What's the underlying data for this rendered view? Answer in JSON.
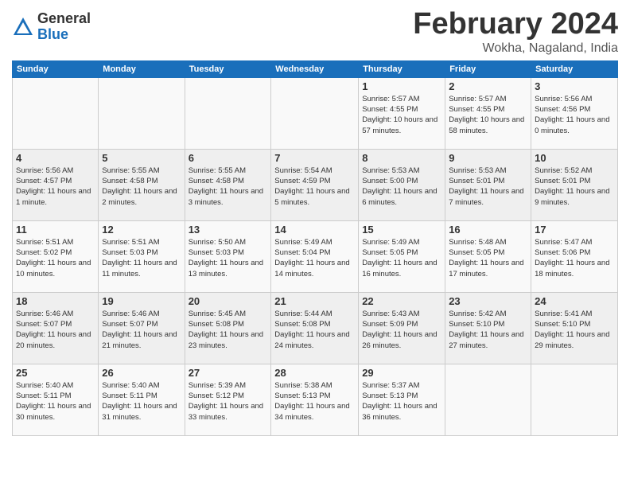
{
  "logo": {
    "general": "General",
    "blue": "Blue"
  },
  "header": {
    "month": "February 2024",
    "location": "Wokha, Nagaland, India"
  },
  "weekdays": [
    "Sunday",
    "Monday",
    "Tuesday",
    "Wednesday",
    "Thursday",
    "Friday",
    "Saturday"
  ],
  "weeks": [
    [
      {
        "day": "",
        "sunrise": "",
        "sunset": "",
        "daylight": ""
      },
      {
        "day": "",
        "sunrise": "",
        "sunset": "",
        "daylight": ""
      },
      {
        "day": "",
        "sunrise": "",
        "sunset": "",
        "daylight": ""
      },
      {
        "day": "",
        "sunrise": "",
        "sunset": "",
        "daylight": ""
      },
      {
        "day": "1",
        "sunrise": "Sunrise: 5:57 AM",
        "sunset": "Sunset: 4:55 PM",
        "daylight": "Daylight: 10 hours and 57 minutes."
      },
      {
        "day": "2",
        "sunrise": "Sunrise: 5:57 AM",
        "sunset": "Sunset: 4:55 PM",
        "daylight": "Daylight: 10 hours and 58 minutes."
      },
      {
        "day": "3",
        "sunrise": "Sunrise: 5:56 AM",
        "sunset": "Sunset: 4:56 PM",
        "daylight": "Daylight: 11 hours and 0 minutes."
      }
    ],
    [
      {
        "day": "4",
        "sunrise": "Sunrise: 5:56 AM",
        "sunset": "Sunset: 4:57 PM",
        "daylight": "Daylight: 11 hours and 1 minute."
      },
      {
        "day": "5",
        "sunrise": "Sunrise: 5:55 AM",
        "sunset": "Sunset: 4:58 PM",
        "daylight": "Daylight: 11 hours and 2 minutes."
      },
      {
        "day": "6",
        "sunrise": "Sunrise: 5:55 AM",
        "sunset": "Sunset: 4:58 PM",
        "daylight": "Daylight: 11 hours and 3 minutes."
      },
      {
        "day": "7",
        "sunrise": "Sunrise: 5:54 AM",
        "sunset": "Sunset: 4:59 PM",
        "daylight": "Daylight: 11 hours and 5 minutes."
      },
      {
        "day": "8",
        "sunrise": "Sunrise: 5:53 AM",
        "sunset": "Sunset: 5:00 PM",
        "daylight": "Daylight: 11 hours and 6 minutes."
      },
      {
        "day": "9",
        "sunrise": "Sunrise: 5:53 AM",
        "sunset": "Sunset: 5:01 PM",
        "daylight": "Daylight: 11 hours and 7 minutes."
      },
      {
        "day": "10",
        "sunrise": "Sunrise: 5:52 AM",
        "sunset": "Sunset: 5:01 PM",
        "daylight": "Daylight: 11 hours and 9 minutes."
      }
    ],
    [
      {
        "day": "11",
        "sunrise": "Sunrise: 5:51 AM",
        "sunset": "Sunset: 5:02 PM",
        "daylight": "Daylight: 11 hours and 10 minutes."
      },
      {
        "day": "12",
        "sunrise": "Sunrise: 5:51 AM",
        "sunset": "Sunset: 5:03 PM",
        "daylight": "Daylight: 11 hours and 11 minutes."
      },
      {
        "day": "13",
        "sunrise": "Sunrise: 5:50 AM",
        "sunset": "Sunset: 5:03 PM",
        "daylight": "Daylight: 11 hours and 13 minutes."
      },
      {
        "day": "14",
        "sunrise": "Sunrise: 5:49 AM",
        "sunset": "Sunset: 5:04 PM",
        "daylight": "Daylight: 11 hours and 14 minutes."
      },
      {
        "day": "15",
        "sunrise": "Sunrise: 5:49 AM",
        "sunset": "Sunset: 5:05 PM",
        "daylight": "Daylight: 11 hours and 16 minutes."
      },
      {
        "day": "16",
        "sunrise": "Sunrise: 5:48 AM",
        "sunset": "Sunset: 5:05 PM",
        "daylight": "Daylight: 11 hours and 17 minutes."
      },
      {
        "day": "17",
        "sunrise": "Sunrise: 5:47 AM",
        "sunset": "Sunset: 5:06 PM",
        "daylight": "Daylight: 11 hours and 18 minutes."
      }
    ],
    [
      {
        "day": "18",
        "sunrise": "Sunrise: 5:46 AM",
        "sunset": "Sunset: 5:07 PM",
        "daylight": "Daylight: 11 hours and 20 minutes."
      },
      {
        "day": "19",
        "sunrise": "Sunrise: 5:46 AM",
        "sunset": "Sunset: 5:07 PM",
        "daylight": "Daylight: 11 hours and 21 minutes."
      },
      {
        "day": "20",
        "sunrise": "Sunrise: 5:45 AM",
        "sunset": "Sunset: 5:08 PM",
        "daylight": "Daylight: 11 hours and 23 minutes."
      },
      {
        "day": "21",
        "sunrise": "Sunrise: 5:44 AM",
        "sunset": "Sunset: 5:08 PM",
        "daylight": "Daylight: 11 hours and 24 minutes."
      },
      {
        "day": "22",
        "sunrise": "Sunrise: 5:43 AM",
        "sunset": "Sunset: 5:09 PM",
        "daylight": "Daylight: 11 hours and 26 minutes."
      },
      {
        "day": "23",
        "sunrise": "Sunrise: 5:42 AM",
        "sunset": "Sunset: 5:10 PM",
        "daylight": "Daylight: 11 hours and 27 minutes."
      },
      {
        "day": "24",
        "sunrise": "Sunrise: 5:41 AM",
        "sunset": "Sunset: 5:10 PM",
        "daylight": "Daylight: 11 hours and 29 minutes."
      }
    ],
    [
      {
        "day": "25",
        "sunrise": "Sunrise: 5:40 AM",
        "sunset": "Sunset: 5:11 PM",
        "daylight": "Daylight: 11 hours and 30 minutes."
      },
      {
        "day": "26",
        "sunrise": "Sunrise: 5:40 AM",
        "sunset": "Sunset: 5:11 PM",
        "daylight": "Daylight: 11 hours and 31 minutes."
      },
      {
        "day": "27",
        "sunrise": "Sunrise: 5:39 AM",
        "sunset": "Sunset: 5:12 PM",
        "daylight": "Daylight: 11 hours and 33 minutes."
      },
      {
        "day": "28",
        "sunrise": "Sunrise: 5:38 AM",
        "sunset": "Sunset: 5:13 PM",
        "daylight": "Daylight: 11 hours and 34 minutes."
      },
      {
        "day": "29",
        "sunrise": "Sunrise: 5:37 AM",
        "sunset": "Sunset: 5:13 PM",
        "daylight": "Daylight: 11 hours and 36 minutes."
      },
      {
        "day": "",
        "sunrise": "",
        "sunset": "",
        "daylight": ""
      },
      {
        "day": "",
        "sunrise": "",
        "sunset": "",
        "daylight": ""
      }
    ]
  ]
}
